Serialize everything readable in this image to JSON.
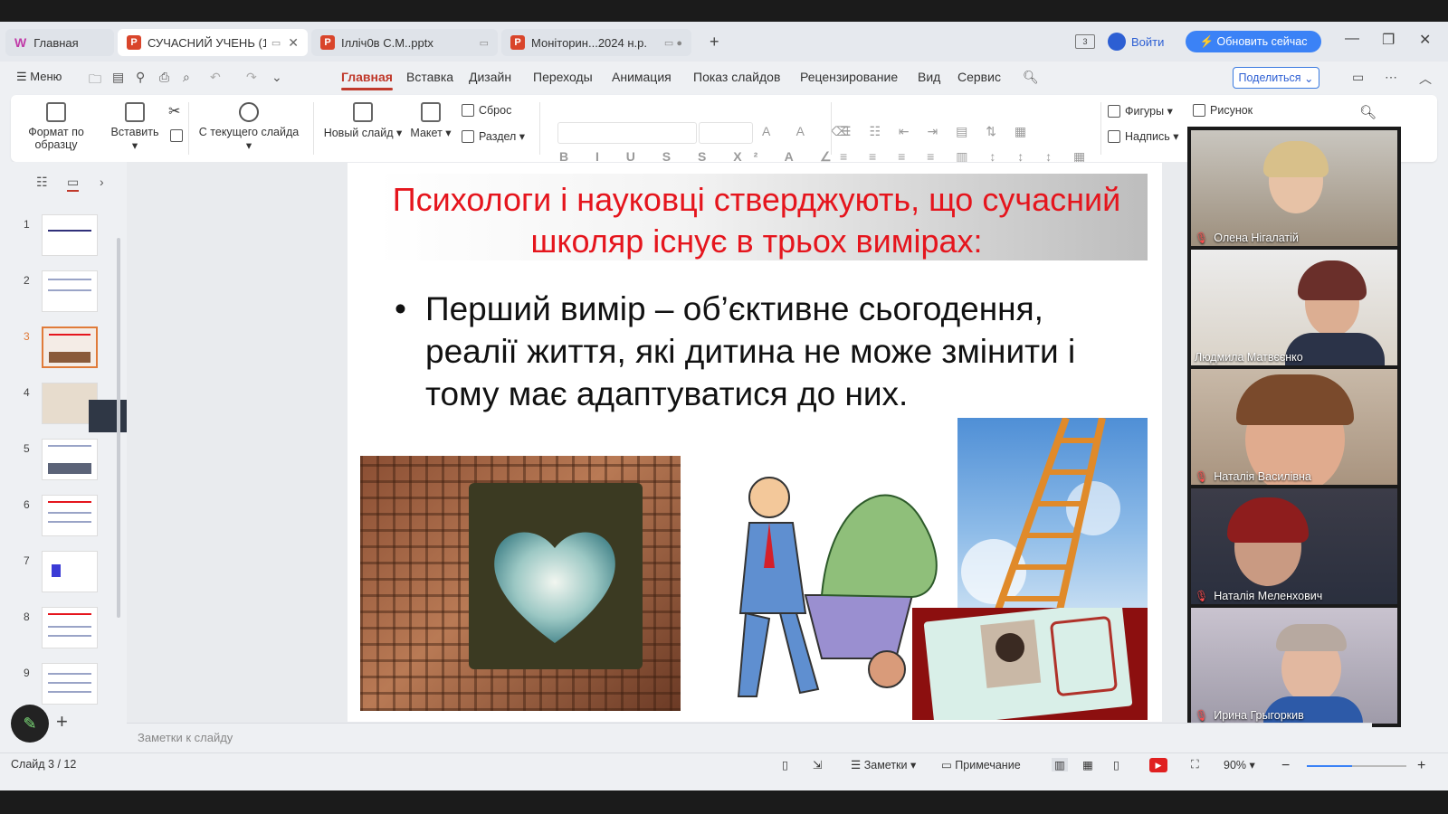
{
  "tabs": {
    "home": "Главная",
    "active": "СУЧАСНИЙ УЧЕНЬ (1)",
    "t2": "Ілліч0в С.М..pptx",
    "t3": "Моніторин...2024 н.р."
  },
  "titlebar": {
    "login": "Войти",
    "upgrade": "Обновить сейчас"
  },
  "menu": {
    "menu_label": "Меню",
    "tabs": [
      "Главная",
      "Вставка",
      "Дизайн",
      "Переходы",
      "Анимация",
      "Показ слайдов",
      "Рецензирование",
      "Вид",
      "Сервис"
    ],
    "share": "Поделиться"
  },
  "ribbon": {
    "format_painter": "Формат по образцу",
    "paste": "Вставить",
    "from_current": "С текущего слайда",
    "new_slide": "Новый слайд",
    "layout": "Макет",
    "reset": "Сброс",
    "section": "Раздел",
    "shapes": "Фигуры",
    "picture": "Рисунок",
    "textbox": "Надпись"
  },
  "thumbnails": [
    1,
    2,
    3,
    4,
    5,
    6,
    7,
    8,
    9
  ],
  "selected_slide": 3,
  "slide": {
    "title": "Психологи і науковці стверджують, що сучасний школяр існує в трьох  вимірах:",
    "bullet": "Перший вимір – об’єктивне сьогодення, реалії життя, які дитина не може змінити і тому має адаптуватися до них."
  },
  "participants": [
    "Олена Нігалатій",
    "Людмила Матвєєнко",
    "Наталія Василівна",
    "Наталія Меленхович",
    "Ирина Грыгоркив"
  ],
  "notes_placeholder": "Заметки к слайду",
  "status": {
    "slide_indicator": "Слайд 3 / 12",
    "notes": "Заметки",
    "comment": "Примечание",
    "zoom": "90%"
  },
  "colors": {
    "accent": "#c0392b",
    "title_red": "#e5151d",
    "upgrade_blue": "#3b82f6"
  }
}
